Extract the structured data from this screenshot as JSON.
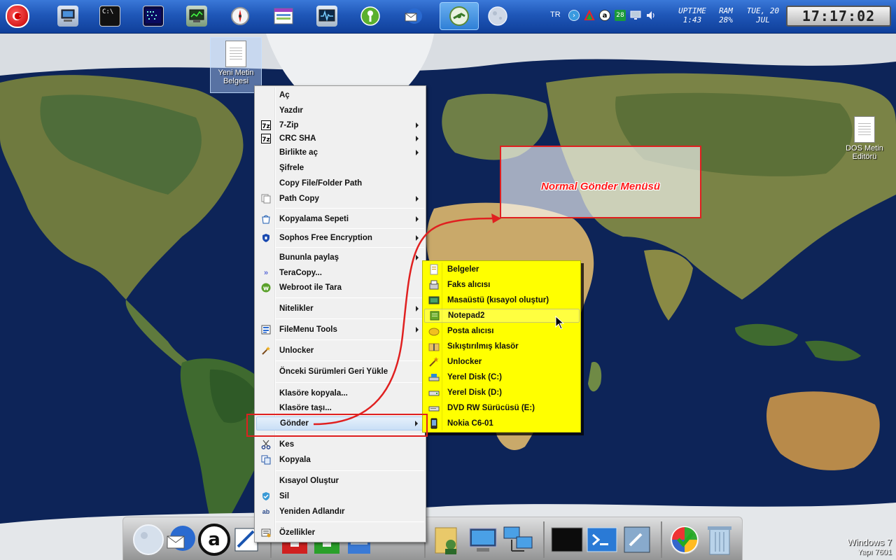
{
  "topbar": {
    "language": "TR",
    "tray_badge": "28",
    "uptime_label": "UPTIME",
    "uptime_value": "1:43",
    "ram_label": "RAM",
    "ram_value": "28%",
    "date_day": "TUE, 20",
    "date_month": "JUL",
    "clock": "17:17:02",
    "icons": [
      "turkish-flag-icon",
      "computer-icon",
      "cmd-icon",
      "terminal-icon",
      "monitor-icon",
      "compass-icon",
      "window-icon",
      "activity-icon",
      "shield-key-icon",
      "mail-icon",
      "connect-icon",
      "moon-icon"
    ]
  },
  "desktop": {
    "icons": [
      {
        "label_line1": "Yeni Metin",
        "label_line2": "Belgesi"
      },
      {
        "label_line1": "DOS Metin",
        "label_line2": "Editörü"
      }
    ]
  },
  "context_menu": {
    "items": [
      {
        "label": "Aç"
      },
      {
        "label": "Yazdır"
      },
      {
        "label": "7-Zip"
      },
      {
        "label": "CRC SHA"
      },
      {
        "label": "Birlikte aç"
      },
      {
        "label": "Şifrele"
      },
      {
        "label": "Copy File/Folder Path"
      },
      {
        "label": "Path Copy"
      },
      {
        "label": "Kopyalama Sepeti"
      },
      {
        "label": "Sophos Free Encryption"
      },
      {
        "label": "Bununla paylaş"
      },
      {
        "label": "TeraCopy..."
      },
      {
        "label": "Webroot ile Tara"
      },
      {
        "label": "Nitelikler"
      },
      {
        "label": "FileMenu Tools"
      },
      {
        "label": "Unlocker"
      },
      {
        "label": "Önceki Sürümleri Geri Yükle"
      },
      {
        "label": "Klasöre kopyala..."
      },
      {
        "label": "Klasöre taşı..."
      },
      {
        "label": "Gönder"
      },
      {
        "label": "Kes"
      },
      {
        "label": "Kopyala"
      },
      {
        "label": "Kısayol Oluştur"
      },
      {
        "label": "Sil"
      },
      {
        "label": "Yeniden Adlandır"
      },
      {
        "label": "Özellikler"
      }
    ]
  },
  "sendto_menu": {
    "items": [
      {
        "label": "Belgeler"
      },
      {
        "label": "Faks alıcısı"
      },
      {
        "label": "Masaüstü (kısayol oluştur)"
      },
      {
        "label": "Notepad2"
      },
      {
        "label": "Posta alıcısı"
      },
      {
        "label": "Sıkıştırılmış klasör"
      },
      {
        "label": "Unlocker"
      },
      {
        "label": "Yerel Disk (C:)"
      },
      {
        "label": "Yerel Disk (D:)"
      },
      {
        "label": "DVD RW Sürücüsü (E:)"
      },
      {
        "label": "Nokia C6-01"
      }
    ]
  },
  "annotation": {
    "text": "Normal Gönder Menüsü",
    "color": "#ff1a1a"
  },
  "watermark": {
    "line1": "Windows 7",
    "line2": "Yapı 7601"
  },
  "colors": {
    "submenu_bg": "#ffff00",
    "menu_bg": "#f0f0f0",
    "highlight_border": "#e02020"
  }
}
